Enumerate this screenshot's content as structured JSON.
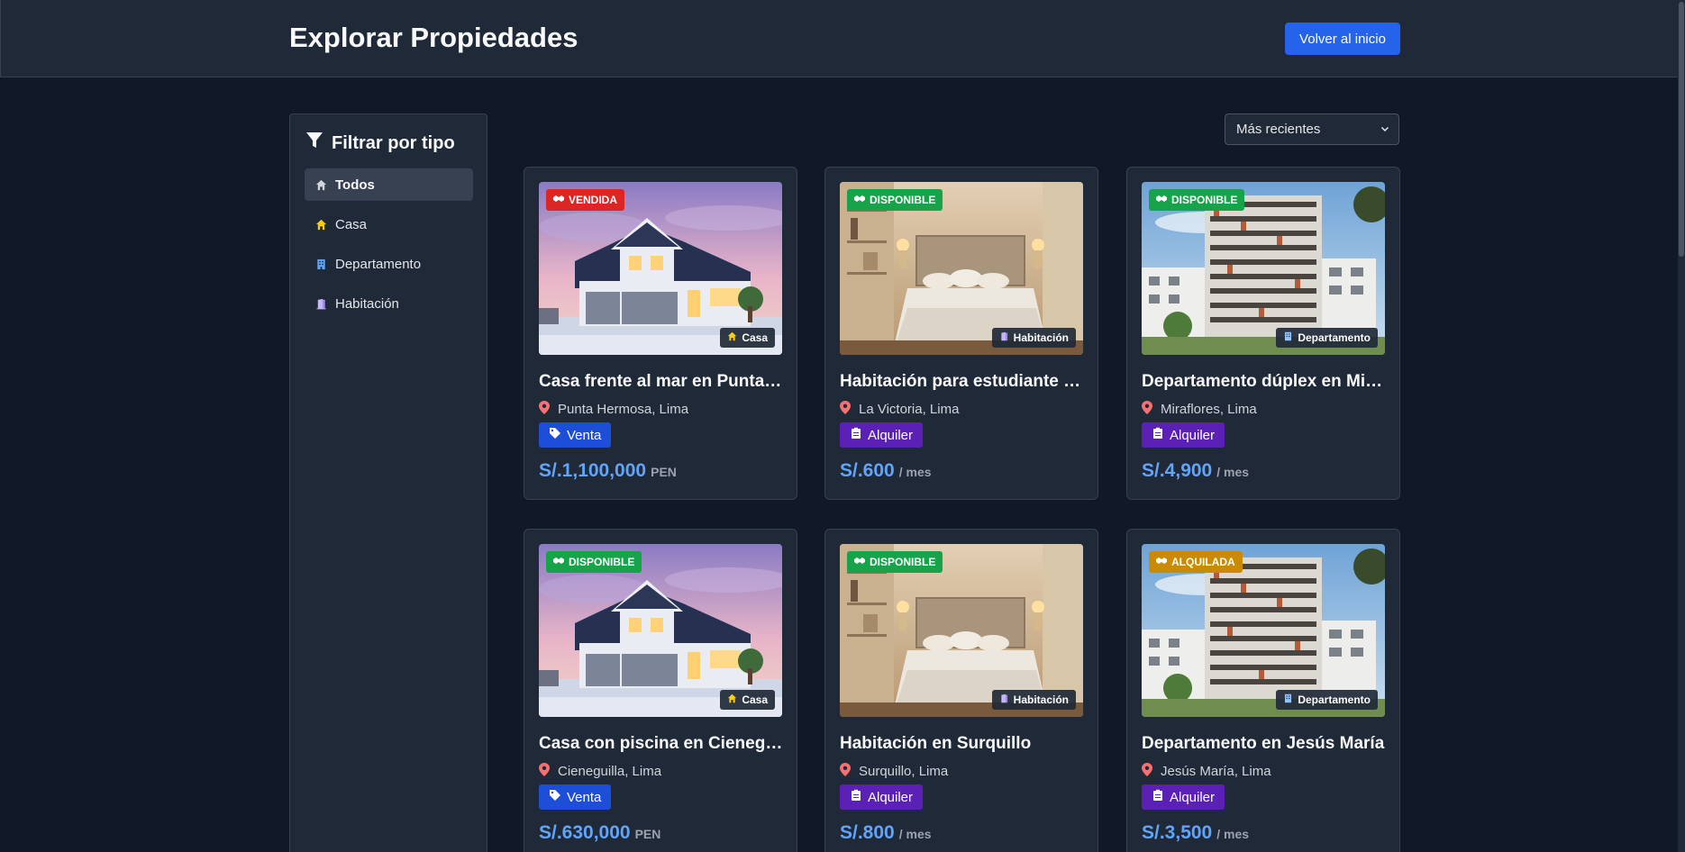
{
  "header": {
    "title": "Explorar Propiedades",
    "back_label": "Volver al inicio"
  },
  "sidebar": {
    "title": "Filtrar por tipo",
    "items": [
      {
        "label": "Todos",
        "icon": "home-icon",
        "active": true
      },
      {
        "label": "Casa",
        "icon": "house-icon",
        "active": false
      },
      {
        "label": "Departamento",
        "icon": "building-icon",
        "active": false
      },
      {
        "label": "Habitación",
        "icon": "door-icon",
        "active": false
      }
    ]
  },
  "sort": {
    "selected": "Más recientes"
  },
  "properties": [
    {
      "status": "VENDIDA",
      "status_color": "#dc2626",
      "type": "Casa",
      "image": "house",
      "title": "Casa frente al mar en Punta Hermosa",
      "location": "Punta Hermosa, Lima",
      "operation": "Venta",
      "price": "S/.1,100,000",
      "price_suffix": "PEN"
    },
    {
      "status": "DISPONIBLE",
      "status_color": "#16a34a",
      "type": "Habitación",
      "image": "bedroom",
      "title": "Habitación para estudiante en La Victoria",
      "location": "La Victoria, Lima",
      "operation": "Alquiler",
      "price": "S/.600",
      "price_suffix": "/ mes"
    },
    {
      "status": "DISPONIBLE",
      "status_color": "#16a34a",
      "type": "Departamento",
      "image": "tower",
      "title": "Departamento dúplex en Miraflores",
      "location": "Miraflores, Lima",
      "operation": "Alquiler",
      "price": "S/.4,900",
      "price_suffix": "/ mes"
    },
    {
      "status": "DISPONIBLE",
      "status_color": "#16a34a",
      "type": "Casa",
      "image": "house",
      "title": "Casa con piscina en Cieneguilla",
      "location": "Cieneguilla, Lima",
      "operation": "Venta",
      "price": "S/.630,000",
      "price_suffix": "PEN"
    },
    {
      "status": "DISPONIBLE",
      "status_color": "#16a34a",
      "type": "Habitación",
      "image": "bedroom",
      "title": "Habitación en Surquillo",
      "location": "Surquillo, Lima",
      "operation": "Alquiler",
      "price": "S/.800",
      "price_suffix": "/ mes"
    },
    {
      "status": "ALQUILADA",
      "status_color": "#ca8a04",
      "type": "Departamento",
      "image": "tower",
      "title": "Departamento en Jesús María",
      "location": "Jesús María, Lima",
      "operation": "Alquiler",
      "price": "S/.3,500",
      "price_suffix": "/ mes"
    }
  ]
}
